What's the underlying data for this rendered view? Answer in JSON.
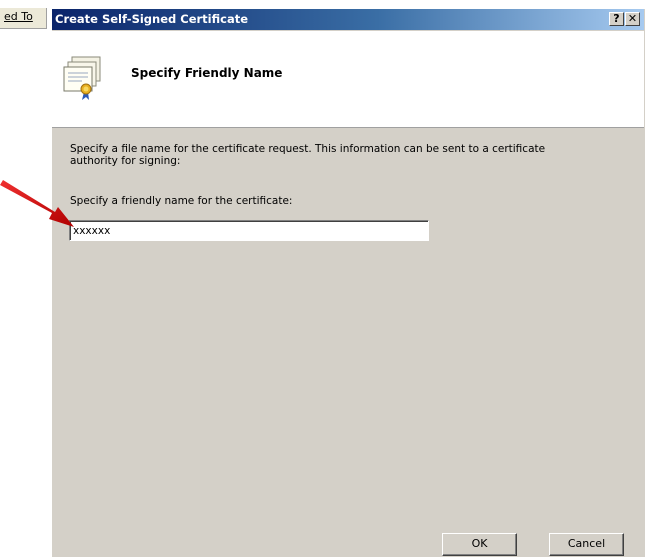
{
  "background_window": {
    "tab_label": "ed To"
  },
  "dialog": {
    "title": "Create Self-Signed Certificate",
    "help_button": "?",
    "close_button": "✕",
    "header_title": "Specify Friendly Name",
    "description": "Specify a file name for the certificate request.  This information can be sent to a certificate authority for signing:",
    "field_label": "Specify a friendly name for the certificate:",
    "friendly_name_value": "xxxxxx",
    "ok_label": "OK",
    "cancel_label": "Cancel"
  },
  "colors": {
    "titlebar_start": "#0a246a",
    "titlebar_end": "#a6caf0",
    "dialog_bg": "#d4d0c8",
    "annotation_arrow": "#e01010"
  },
  "icons": [
    "certificate-icon",
    "annotation-arrow"
  ]
}
